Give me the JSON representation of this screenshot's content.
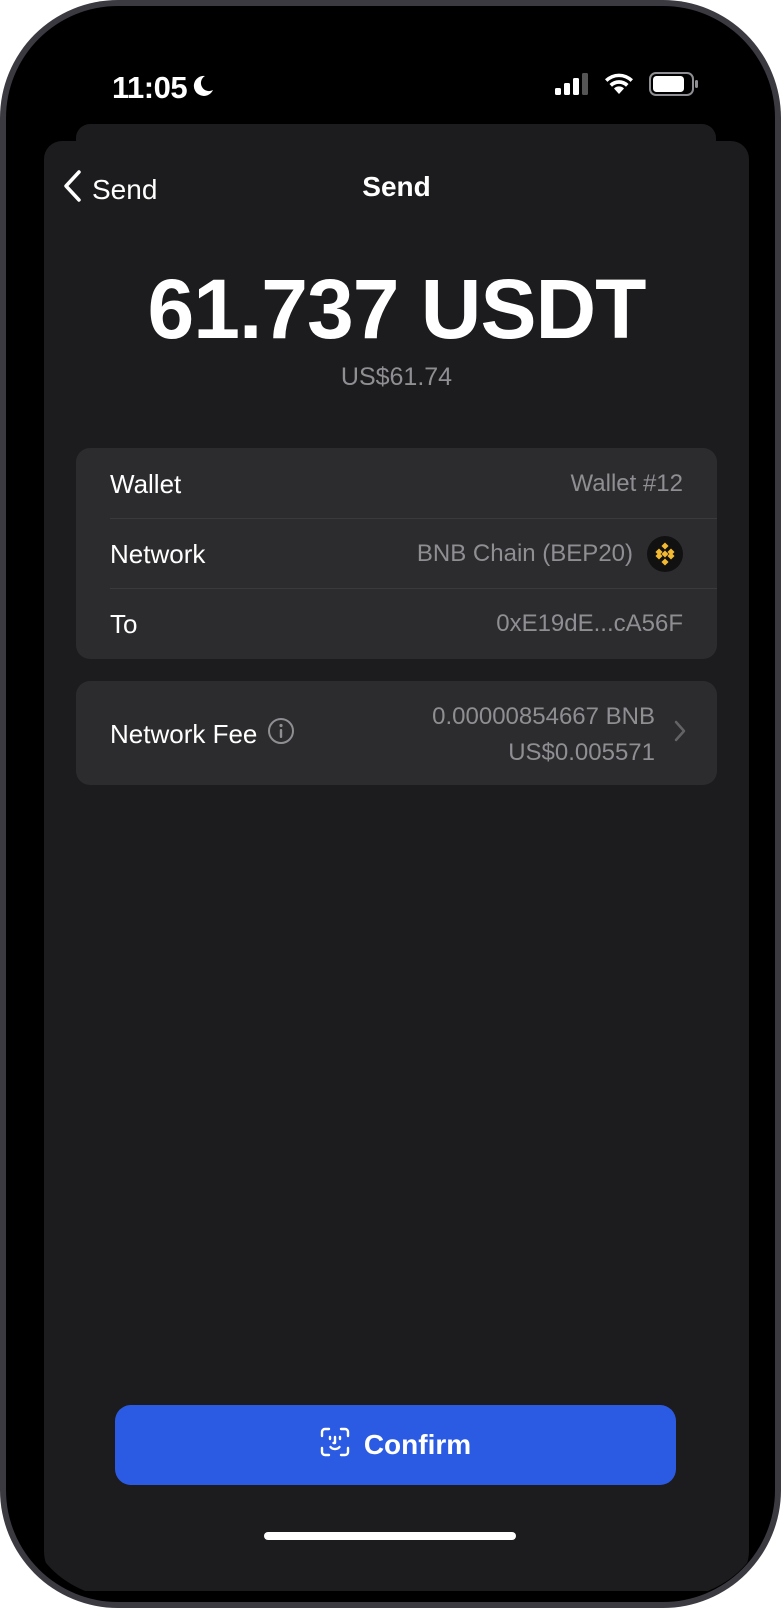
{
  "status_bar": {
    "time": "11:05"
  },
  "nav": {
    "back_label": "Send",
    "title": "Send"
  },
  "amount": {
    "crypto": "61.737 USDT",
    "fiat": "US$61.74"
  },
  "details": {
    "wallet_label": "Wallet",
    "wallet_value": "Wallet #12",
    "network_label": "Network",
    "network_value": "BNB Chain (BEP20)",
    "to_label": "To",
    "to_value": "0xE19dE...cA56F"
  },
  "fee": {
    "label": "Network Fee",
    "crypto": "0.00000854667 BNB",
    "fiat": "US$0.005571"
  },
  "confirm": {
    "label": "Confirm"
  },
  "colors": {
    "accent": "#2c5be3",
    "bnb_yellow": "#f3ba2f",
    "sheet": "#1c1c1e",
    "card": "#2c2c2e"
  }
}
